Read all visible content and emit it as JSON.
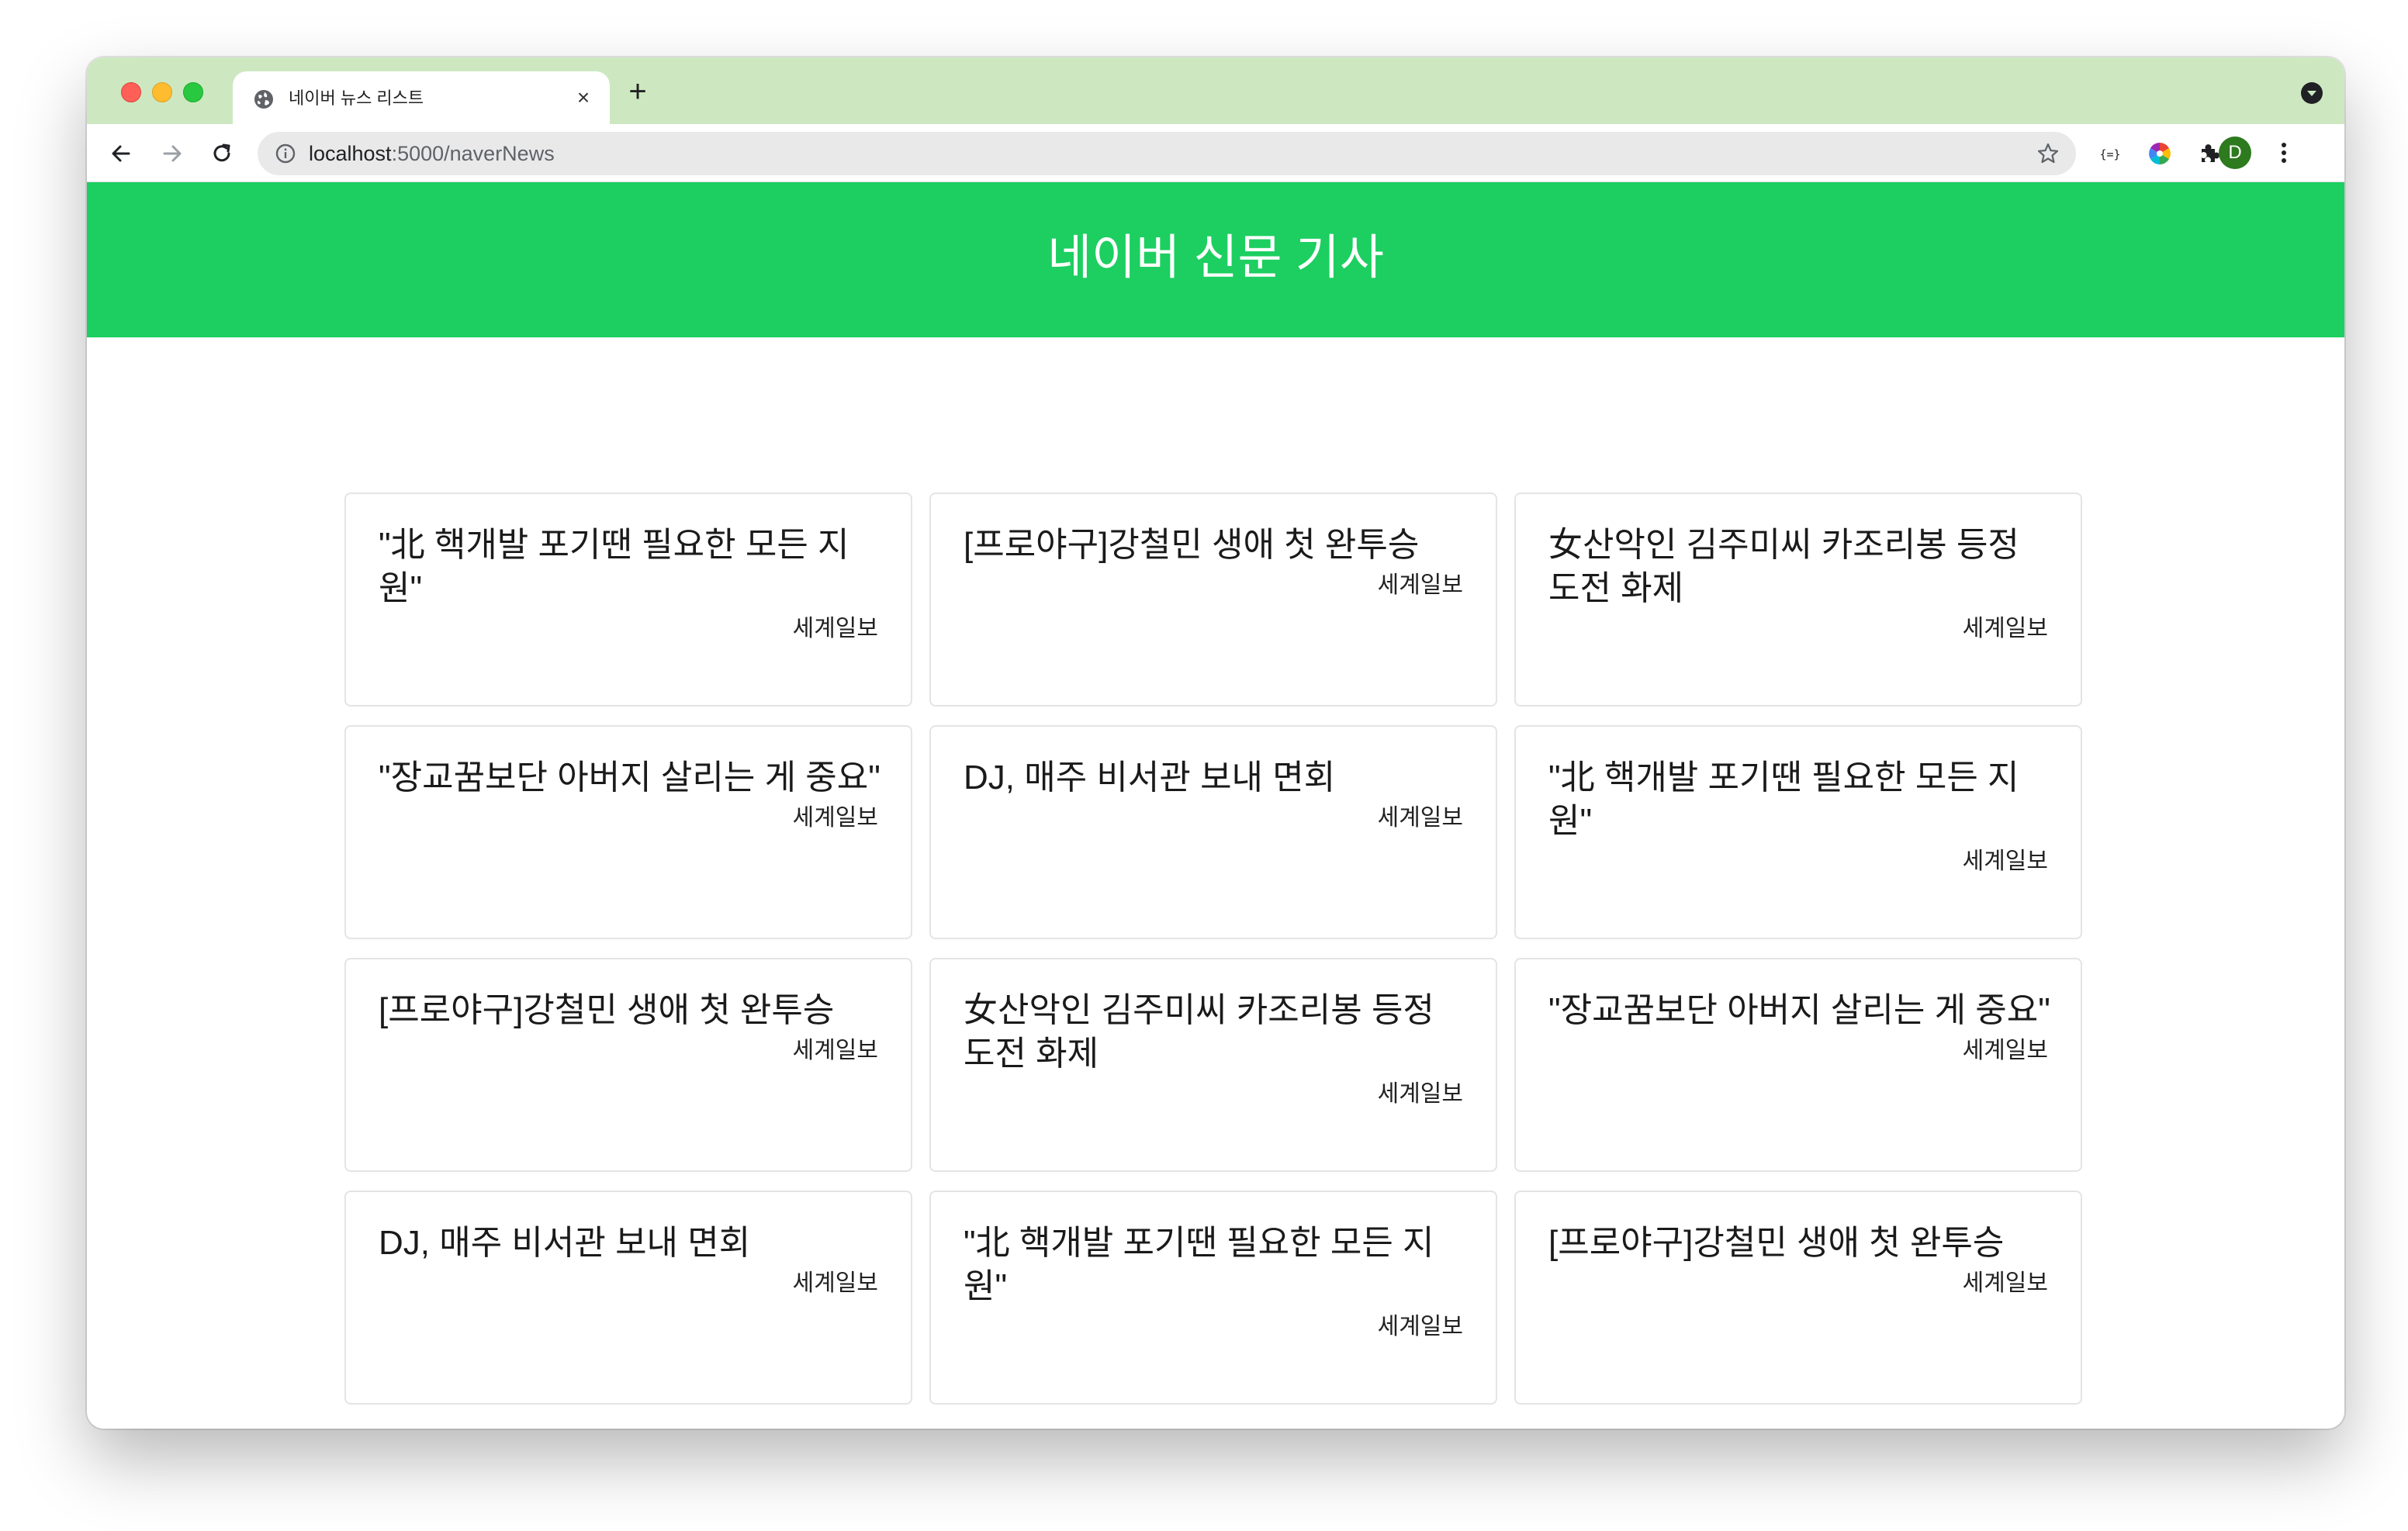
{
  "browser": {
    "tab": {
      "title": "네이버 뉴스 리스트",
      "close_glyph": "×"
    },
    "new_tab_glyph": "+",
    "address": {
      "host": "localhost",
      "path": ":5000/naverNews"
    },
    "profile_initial": "D",
    "colors": {
      "tabstrip": "#cde8c0",
      "profile": "#2d7a1f"
    }
  },
  "page": {
    "title": "네이버 신문 기사",
    "header_color": "#1ccf60"
  },
  "articles": [
    {
      "title": "\"北 핵개발 포기땐 필요한 모든 지원\"",
      "source": "세계일보"
    },
    {
      "title": "[프로야구]강철민 생애 첫 완투승",
      "source": "세계일보"
    },
    {
      "title": "女산악인 김주미씨 카조리봉 등정 도전 화제",
      "source": "세계일보"
    },
    {
      "title": "\"장교꿈보단 아버지 살리는 게 중요\"",
      "source": "세계일보"
    },
    {
      "title": "DJ, 매주 비서관 보내 면회",
      "source": "세계일보"
    },
    {
      "title": "\"北 핵개발 포기땐 필요한 모든 지원\"",
      "source": "세계일보"
    },
    {
      "title": "[프로야구]강철민 생애 첫 완투승",
      "source": "세계일보"
    },
    {
      "title": "女산악인 김주미씨 카조리봉 등정 도전 화제",
      "source": "세계일보"
    },
    {
      "title": "\"장교꿈보단 아버지 살리는 게 중요\"",
      "source": "세계일보"
    },
    {
      "title": "DJ, 매주 비서관 보내 면회",
      "source": "세계일보"
    },
    {
      "title": "\"北 핵개발 포기땐 필요한 모든 지원\"",
      "source": "세계일보"
    },
    {
      "title": "[프로야구]강철민 생애 첫 완투승",
      "source": "세계일보"
    }
  ]
}
